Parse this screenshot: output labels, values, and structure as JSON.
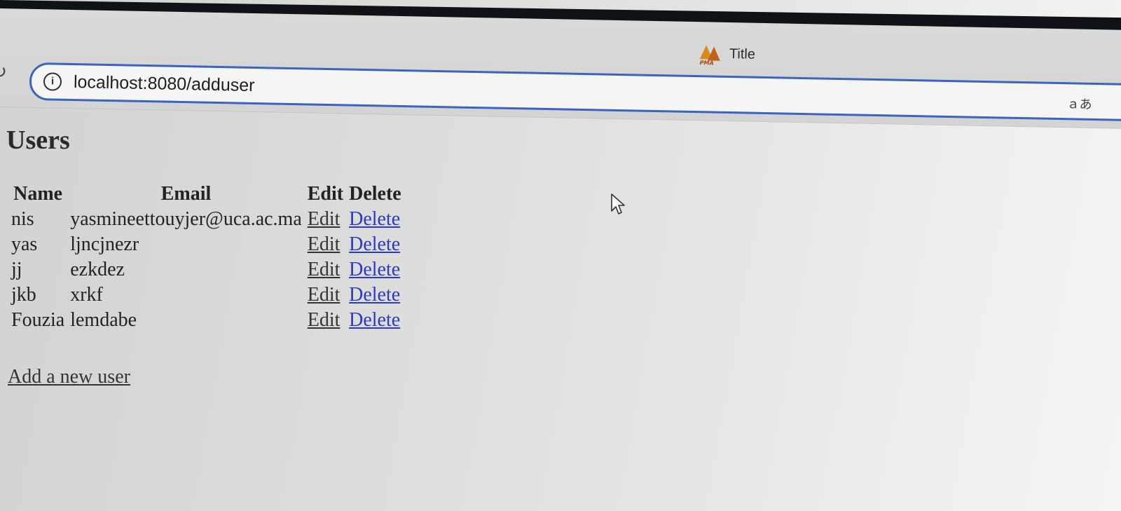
{
  "browser": {
    "tab_title": "Title",
    "favicon_text": "PMA",
    "url": "localhost:8080/adduser",
    "translate_glyph": "ａあ"
  },
  "page": {
    "heading": "Users",
    "table": {
      "headers": {
        "name": "Name",
        "email": "Email",
        "edit": "Edit",
        "delete": "Delete"
      },
      "rows": [
        {
          "name": "nis",
          "email": "yasmineettouyjer@uca.ac.ma",
          "edit": "Edit",
          "delete": "Delete"
        },
        {
          "name": "yas",
          "email": "ljncjnezr",
          "edit": "Edit",
          "delete": "Delete"
        },
        {
          "name": "jj",
          "email": "ezkdez",
          "edit": "Edit",
          "delete": "Delete"
        },
        {
          "name": "jkb",
          "email": "xrkf",
          "edit": "Edit",
          "delete": "Delete"
        },
        {
          "name": "Fouzia",
          "email": "lemdabe",
          "edit": "Edit",
          "delete": "Delete"
        }
      ]
    },
    "add_link": "Add a new user"
  },
  "icons": {
    "reload": "reload-icon",
    "info": "info-icon",
    "translate": "translate-icon",
    "cursor": "mouse-pointer-icon"
  },
  "colors": {
    "address_bar_border": "#3b63c4",
    "link_blue": "#2a39c8",
    "favicon_orange": "#d98a1e"
  }
}
